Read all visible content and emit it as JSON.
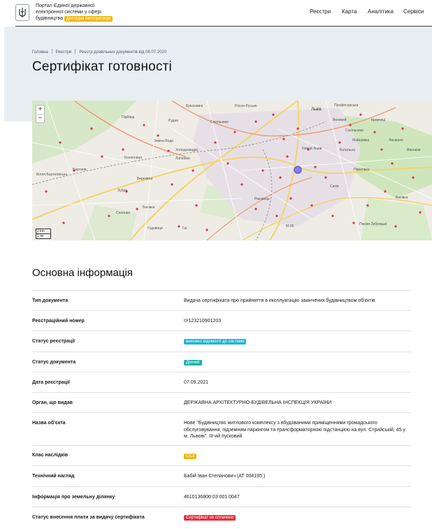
{
  "header": {
    "portal_line1": "Портал Єдиної державної",
    "portal_line2": "електронної системи у сфері",
    "portal_line3": "будівництва",
    "beta_label": "Дослідна експлуатація",
    "nav": [
      "Реєстри",
      "Карта",
      "Аналітика",
      "Сервіси"
    ]
  },
  "breadcrumb": [
    "Головна",
    "Реєстри",
    "Реєстр дозвільних документів від 06.07.2020"
  ],
  "page_title": "Сертифікат готовності",
  "map": {
    "zoom_in": "+",
    "zoom_out": "−",
    "scale_km": "2 km",
    "scale_mi": "1 mi",
    "labels": [
      "Львів",
      "Рудне",
      "Професорська",
      "Підбірці",
      "Великий",
      "Кривчиці",
      "Сокільники",
      "Майорівка",
      "Винники",
      "Новий Львів",
      "Батальна",
      "Холодновідка",
      "Зимна Вода",
      "Конопниця",
      "Вілля Бартатівська",
      "Бартатів",
      "Лапаївка",
      "Лисиничі",
      "Пирогівка",
      "Сихів",
      "Березина",
      "Зубра",
      "Басівка",
      "Солонка",
      "Гаї",
      "Годовиця",
      "Раковець",
      "Басівка",
      "Пасіки-Зубрицькі",
      "Рясне-Руське",
      "Брюховичі",
      "Сокільники",
      "М-06"
    ]
  },
  "main_section_title": "Основна інформація",
  "rows": [
    {
      "label": "Тип документа",
      "value": "Видача сертифіката про прийняття в експлуатацію закінчених будівництвом об'єктів"
    },
    {
      "label": "Реєстраційний номер",
      "value": "ІУ123210901203"
    },
    {
      "label": "Статус реєстрації",
      "value": "внесено відомості до системи"
    },
    {
      "label": "Статус документа",
      "value": "Діючий"
    },
    {
      "label": "Дата реєстрації",
      "value": "07.09.2021"
    },
    {
      "label": "Орган, що видав",
      "value": "ДЕРЖАВНА АРХІТЕКТУРНО-БУДІВЕЛЬНА ІНСПЕКЦІЯ УКРАЇНИ"
    },
    {
      "label": "Назва об'єкта",
      "value": "Нове \"Будівництво житлового комплексу з вбудованими приміщеннями громадського обслуговування, підземним паркінгом та трансформаторною підстанцією на вул. Стрийській, 45 у м. Львові\". ІІІ-ий пусковий"
    },
    {
      "label": "Клас наслідків",
      "value": "СС3"
    },
    {
      "label": "Технічний нагляд",
      "value": "Бабій Іван Степанович (АТ 004195 )"
    },
    {
      "label": "Інформація про земельну ділянку",
      "value": "4610136800:03:001:0047"
    },
    {
      "label": "Статус внесення плати за видачу сертифіката",
      "value": "Сертифікат не сплачено"
    }
  ],
  "colors": {
    "registration_status": "#1fb5d6",
    "document_status": "#19b3a6",
    "consequence_class": "#f2b705",
    "payment_status": "#e5303f",
    "beta": "#f2b705"
  }
}
